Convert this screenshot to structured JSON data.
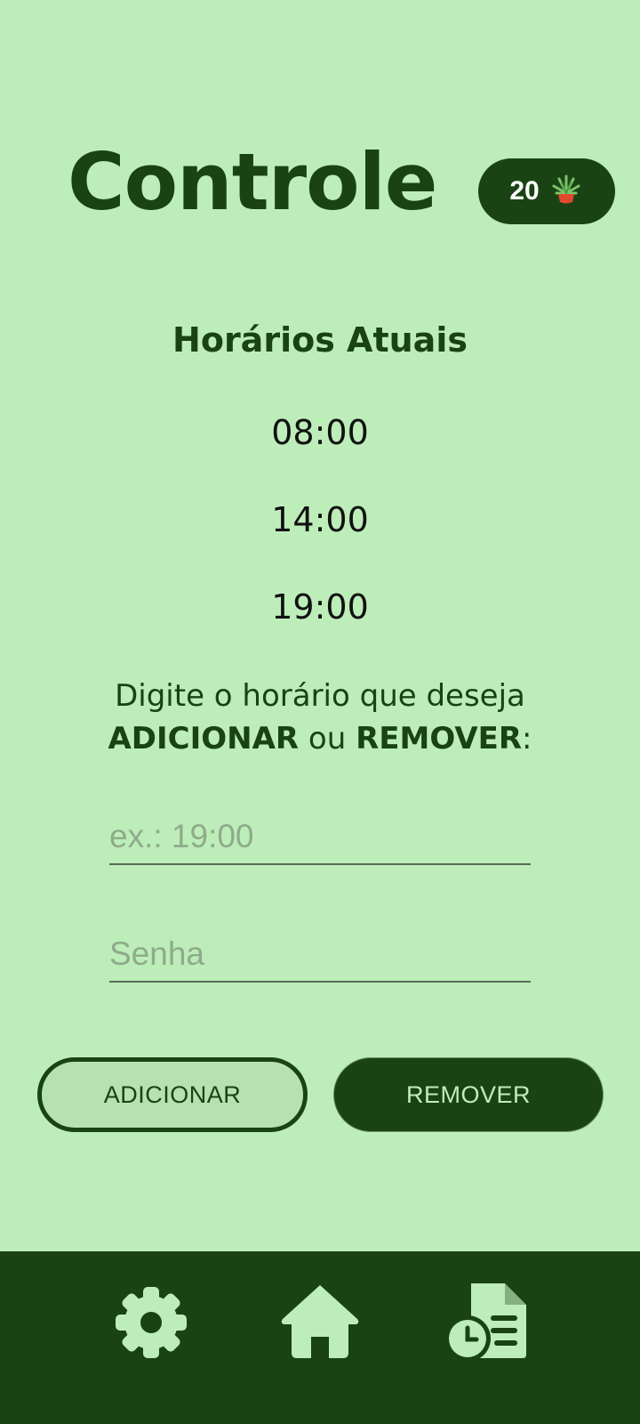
{
  "header": {
    "title": "Controle",
    "badge_count": "20",
    "badge_icon": "potted-plant-icon"
  },
  "schedule": {
    "heading": "Horários Atuais",
    "times": [
      "08:00",
      "14:00",
      "19:00"
    ]
  },
  "instruction": {
    "line1": "Digite o horário que deseja",
    "add_word": "ADICIONAR",
    "connector": " ou ",
    "remove_word": "REMOVER",
    "suffix": ":"
  },
  "form": {
    "time_placeholder": "ex.: 19:00",
    "password_placeholder": "Senha"
  },
  "actions": {
    "add_label": "ADICIONAR",
    "remove_label": "REMOVER"
  },
  "nav": {
    "items": [
      "gear-icon",
      "home-icon",
      "report-clock-icon"
    ]
  },
  "colors": {
    "background": "#bdeeb9",
    "primary": "#1a4314"
  }
}
